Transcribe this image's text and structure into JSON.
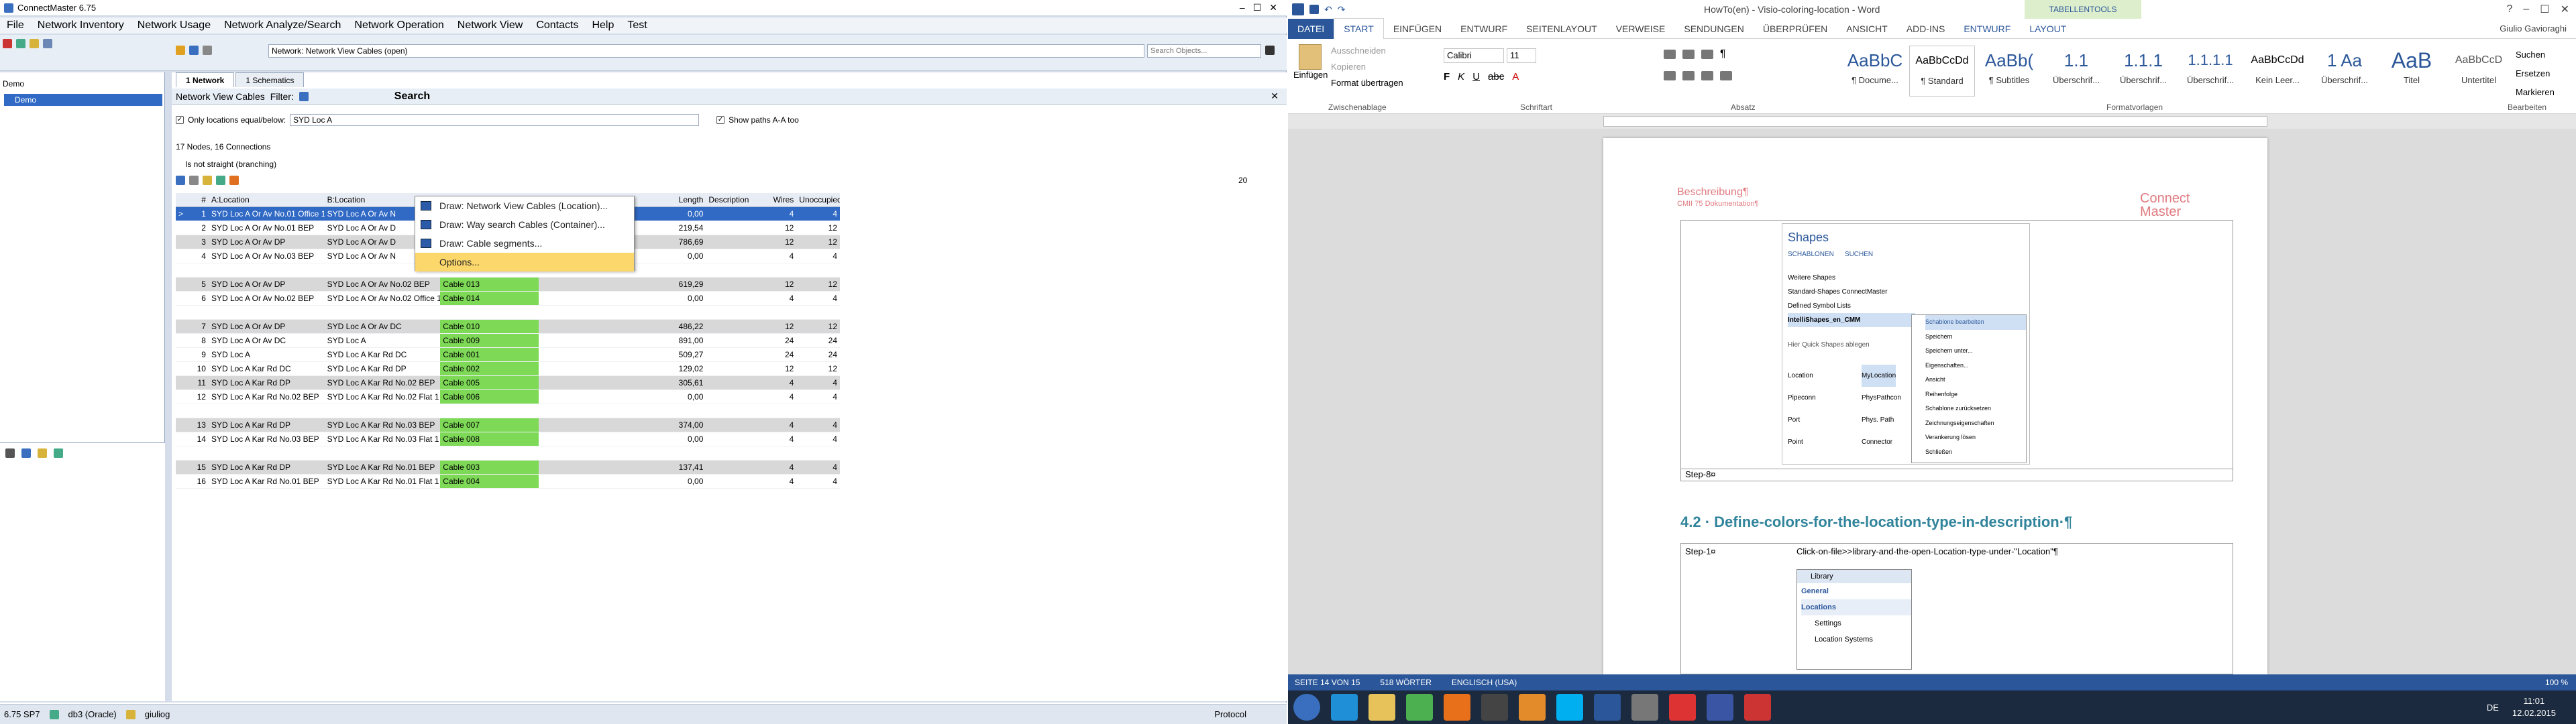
{
  "cm": {
    "title": "ConnectMaster 6.75",
    "menu": [
      "File",
      "Network Inventory",
      "Network Usage",
      "Network Analyze/Search",
      "Network Operation",
      "Network View",
      "Contacts",
      "Help",
      "Test"
    ],
    "network_select": "Network: Network View Cables  (open)",
    "search_placeholder": "Search Objects...",
    "tree_root": "Demo",
    "tree_item": "Demo",
    "tabs": [
      "1 Network",
      "1 Schematics"
    ],
    "sub_label": "Network View Cables",
    "filter_label": "Filter:",
    "search_label": "Search",
    "only_locations_label": "Only locations equal/below:",
    "only_locations_value": "SYD Loc A",
    "show_paths_label": "Show paths A-A too",
    "summary": "17 Nodes, 16 Connections",
    "not_straight": "Is not straight (branching)",
    "page_count": "20",
    "columns": [
      "#",
      "A:Location",
      "B:Location",
      "",
      "",
      "",
      "Length",
      "Description",
      "Wires",
      "Unoccupied"
    ],
    "rows": [
      {
        "n": "1",
        "a": "SYD Loc A Or Av No.01 Office 1",
        "b": "SYD Loc A Or Av N",
        "cable": "",
        "len": "0,00",
        "desc": "",
        "wires": "4",
        "unocc": "4",
        "style": "sel"
      },
      {
        "n": "2",
        "a": "SYD Loc A Or Av No.01 BEP",
        "b": "SYD Loc A Or Av D",
        "cable": "",
        "len": "219,54",
        "desc": "",
        "wires": "12",
        "unocc": "12",
        "style": ""
      },
      {
        "n": "3",
        "a": "SYD Loc A Or Av DP",
        "b": "SYD Loc A Or Av D",
        "cable": "",
        "len": "786,69",
        "desc": "",
        "wires": "12",
        "unocc": "12",
        "style": "grey"
      },
      {
        "n": "4",
        "a": "SYD Loc A Or Av No.03 BEP",
        "b": "SYD Loc A Or Av N",
        "cable": "",
        "len": "0,00",
        "desc": "",
        "wires": "4",
        "unocc": "4",
        "style": ""
      },
      {
        "n": "",
        "a": "",
        "b": "",
        "cable": "",
        "len": "",
        "desc": "",
        "wires": "",
        "unocc": "",
        "style": "blank"
      },
      {
        "n": "5",
        "a": "SYD Loc A Or Av DP",
        "b": "SYD Loc A Or Av No.02 BEP",
        "cable": "Cable 013",
        "len": "619,29",
        "desc": "",
        "wires": "12",
        "unocc": "12",
        "style": "grey"
      },
      {
        "n": "6",
        "a": "SYD Loc A Or Av No.02 BEP",
        "b": "SYD Loc A Or Av No.02 Office 1",
        "cable": "Cable 014",
        "len": "0,00",
        "desc": "",
        "wires": "4",
        "unocc": "4",
        "style": ""
      },
      {
        "n": "",
        "a": "",
        "b": "",
        "cable": "",
        "len": "",
        "desc": "",
        "wires": "",
        "unocc": "",
        "style": "blank"
      },
      {
        "n": "7",
        "a": "SYD Loc A Or Av DP",
        "b": "SYD Loc A Or Av DC",
        "cable": "Cable 010",
        "len": "486,22",
        "desc": "",
        "wires": "12",
        "unocc": "12",
        "style": "grey"
      },
      {
        "n": "8",
        "a": "SYD Loc A Or Av DC",
        "b": "SYD Loc A",
        "cable": "Cable 009",
        "len": "891,00",
        "desc": "",
        "wires": "24",
        "unocc": "24",
        "style": ""
      },
      {
        "n": "9",
        "a": "SYD Loc A",
        "b": "SYD Loc A Kar Rd DC",
        "cable": "Cable 001",
        "len": "509,27",
        "desc": "",
        "wires": "24",
        "unocc": "24",
        "style": ""
      },
      {
        "n": "10",
        "a": "SYD Loc A Kar Rd DC",
        "b": "SYD Loc A Kar Rd DP",
        "cable": "Cable 002",
        "len": "129,02",
        "desc": "",
        "wires": "12",
        "unocc": "12",
        "style": ""
      },
      {
        "n": "11",
        "a": "SYD Loc A Kar Rd DP",
        "b": "SYD Loc A Kar Rd No.02 BEP",
        "cable": "Cable 005",
        "len": "305,61",
        "desc": "",
        "wires": "4",
        "unocc": "4",
        "style": "grey"
      },
      {
        "n": "12",
        "a": "SYD Loc A Kar Rd No.02 BEP",
        "b": "SYD Loc A Kar Rd No.02 Flat 1",
        "cable": "Cable 006",
        "len": "0,00",
        "desc": "",
        "wires": "4",
        "unocc": "4",
        "style": ""
      },
      {
        "n": "",
        "a": "",
        "b": "",
        "cable": "",
        "len": "",
        "desc": "",
        "wires": "",
        "unocc": "",
        "style": "blank"
      },
      {
        "n": "13",
        "a": "SYD Loc A Kar Rd DP",
        "b": "SYD Loc A Kar Rd No.03 BEP",
        "cable": "Cable 007",
        "len": "374,00",
        "desc": "",
        "wires": "4",
        "unocc": "4",
        "style": "grey"
      },
      {
        "n": "14",
        "a": "SYD Loc A Kar Rd No.03 BEP",
        "b": "SYD Loc A Kar Rd No.03 Flat 1",
        "cable": "Cable 008",
        "len": "0,00",
        "desc": "",
        "wires": "4",
        "unocc": "4",
        "style": ""
      },
      {
        "n": "",
        "a": "",
        "b": "",
        "cable": "",
        "len": "",
        "desc": "",
        "wires": "",
        "unocc": "",
        "style": "blank"
      },
      {
        "n": "15",
        "a": "SYD Loc A Kar Rd DP",
        "b": "SYD Loc A Kar Rd No.01 BEP",
        "cable": "Cable 003",
        "len": "137,41",
        "desc": "",
        "wires": "4",
        "unocc": "4",
        "style": "grey"
      },
      {
        "n": "16",
        "a": "SYD Loc A Kar Rd No.01 BEP",
        "b": "SYD Loc A Kar Rd No.01 Flat 1",
        "cable": "Cable 004",
        "len": "0,00",
        "desc": "",
        "wires": "4",
        "unocc": "4",
        "style": ""
      }
    ],
    "context_menu": [
      "Draw: Network View Cables (Location)...",
      "Draw: Way search Cables (Container)...",
      "Draw: Cable segments...",
      "Options..."
    ],
    "status": {
      "version": "6.75 SP7",
      "db": "db3 (Oracle)",
      "user": "giuliog",
      "protocol": "Protocol"
    }
  },
  "word": {
    "title": "HowTo(en) - Visio-coloring-location - Word",
    "tabletools": "TABELLENTOOLS",
    "user": "Giulio Gavioraghi",
    "tabs": [
      "DATEI",
      "START",
      "EINFÜGEN",
      "ENTWURF",
      "SEITENLAYOUT",
      "VERWEISE",
      "SENDUNGEN",
      "ÜBERPRÜFEN",
      "ANSICHT",
      "ADD-INS",
      "ENTWURF",
      "LAYOUT"
    ],
    "clipboard": {
      "paste": "Einfügen",
      "cut": "Ausschneiden",
      "copy": "Kopieren",
      "format": "Format übertragen",
      "label": "Zwischenablage"
    },
    "font": {
      "name": "Calibri",
      "size": "11",
      "label": "Schriftart"
    },
    "paragraph_label": "Absatz",
    "styles": [
      {
        "preview": "AaBbC",
        "name": "¶ Docume..."
      },
      {
        "preview": "AaBbCcDd",
        "name": "¶ Standard"
      },
      {
        "preview": "AaBb(",
        "name": "¶ Subtitles"
      },
      {
        "preview": "1.1",
        "name": "Überschrif..."
      },
      {
        "preview": "1.1.1",
        "name": "Überschrif..."
      },
      {
        "preview": "1.1.1.1",
        "name": "Überschrif..."
      },
      {
        "preview": "AaBbCcDd",
        "name": "Kein Leer..."
      },
      {
        "preview": "1 Aa",
        "name": "Überschrif..."
      },
      {
        "preview": "AaB",
        "name": "Titel"
      },
      {
        "preview": "AaBbCcD",
        "name": "Untertitel"
      }
    ],
    "styles_label": "Formatvorlagen",
    "editing": {
      "search": "Suchen",
      "replace": "Ersetzen",
      "mark": "Markieren",
      "label": "Bearbeiten"
    },
    "doc": {
      "header_left": "Beschreibung¶",
      "header_left_sub": "CMII 75 Dokumentation¶",
      "header_right": "Connect Master",
      "step8": "Step-8¤",
      "heading": "4.2 · Define-colors-for-the-location-type-in-description·¶",
      "step1": "Step-1¤",
      "step1_text": "Click-on-file>>library-and-the-open-Location-type-under-\"Location\"¶",
      "shapes_title": "Shapes",
      "shapes_tabs": [
        "SCHABLONEN",
        "SUCHEN"
      ],
      "shapes_items": [
        "Weitere Shapes",
        "Standard-Shapes ConnectMaster",
        "Defined Symbol Lists",
        "IntelliShapes_en_CMM"
      ],
      "quick_shapes": "Hier Quick Shapes ablegen",
      "shape_labels": [
        "Location",
        "MyLocation",
        "Pipeconn",
        "PhysPathcon",
        "Port",
        "Phys. Path",
        "Point",
        "Connector"
      ],
      "shape_menu": [
        "Schablone bearbeiten",
        "Speichern",
        "Speichern unter...",
        "Eigenschaften...",
        "Ansicht",
        "Reihenfolge",
        "Schablone zurücksetzen",
        "Zeichnungseigenschaften",
        "Verankerung lösen",
        "Schließen"
      ],
      "library_title": "Library",
      "library_items": [
        "General",
        "Locations",
        "Settings",
        "Location Systems"
      ]
    },
    "status": {
      "page": "SEITE 14 VON 15",
      "words": "518 WÖRTER",
      "lang": "ENGLISCH (USA)",
      "zoom": "100 %"
    },
    "clock": {
      "time": "11:01",
      "date": "12.02.2015"
    },
    "lang_indicator": "DE"
  }
}
